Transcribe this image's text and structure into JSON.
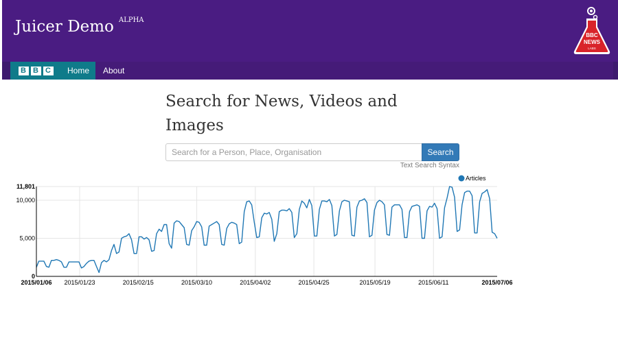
{
  "header": {
    "title": "Juicer Demo",
    "badge": "ALPHA",
    "logo": {
      "icon": "bbc-news-labs-flask-icon",
      "lines": [
        "BBC",
        "NEWS",
        "LABS"
      ],
      "color": "#d9232a"
    },
    "background": "#4a1c82"
  },
  "nav": {
    "brand_letters": [
      "B",
      "B",
      "C"
    ],
    "items": [
      {
        "label": "Home",
        "active": true
      },
      {
        "label": "About",
        "active": false
      }
    ],
    "accent": "#0f7b8a"
  },
  "main": {
    "title": "Search for News, Videos and Images",
    "search": {
      "placeholder": "Search for a Person, Place, Organisation",
      "value": "",
      "button_label": "Search"
    },
    "syntax_link": "Text Search Syntax"
  },
  "chart_data": {
    "type": "line",
    "series": [
      {
        "name": "Articles",
        "color": "#1f77b4"
      }
    ],
    "y_ticks": [
      "0",
      "5,000",
      "10,000",
      "11,801"
    ],
    "ylim": [
      0,
      11801
    ],
    "x_ticks": [
      "2015/01/06",
      "2015/01/23",
      "2015/02/15",
      "2015/03/10",
      "2015/04/02",
      "2015/04/25",
      "2015/05/19",
      "2015/06/11",
      "2015/07/06"
    ],
    "x_range": [
      "2015/01/06",
      "2015/07/06"
    ],
    "grid": true,
    "legend": "top-right",
    "values": [
      1200,
      2000,
      2000,
      2000,
      1300,
      1200,
      2100,
      2100,
      2200,
      2100,
      1900,
      1200,
      1200,
      1900,
      1900,
      1900,
      1900,
      1900,
      1100,
      1300,
      1700,
      2000,
      2100,
      2100,
      1300,
      500,
      1800,
      2100,
      1900,
      2200,
      3400,
      4200,
      3000,
      3200,
      5000,
      5200,
      5300,
      5600,
      4800,
      3000,
      3000,
      5200,
      5200,
      4900,
      5100,
      4800,
      3300,
      3400,
      5600,
      6200,
      5900,
      6800,
      6800,
      4300,
      3700,
      7000,
      7300,
      7200,
      6800,
      6400,
      4200,
      4100,
      6000,
      6500,
      7200,
      7100,
      6500,
      4100,
      4100,
      6600,
      6800,
      7000,
      7200,
      6800,
      4200,
      4100,
      6300,
      6900,
      7100,
      7000,
      6800,
      4300,
      4500,
      8500,
      9800,
      9900,
      9400,
      7100,
      5100,
      5200,
      7700,
      8300,
      8200,
      8400,
      7500,
      4600,
      5600,
      8500,
      8700,
      8700,
      8600,
      8900,
      8400,
      5100,
      5600,
      8800,
      9900,
      9600,
      9000,
      10100,
      9300,
      5300,
      5300,
      8800,
      9900,
      9900,
      9800,
      10100,
      9300,
      5300,
      5500,
      8600,
      9800,
      10000,
      9900,
      9800,
      5400,
      5300,
      9100,
      9900,
      10000,
      10200,
      9700,
      5200,
      5400,
      8700,
      9700,
      10000,
      9800,
      9400,
      5500,
      5400,
      9100,
      9400,
      9400,
      9400,
      8800,
      5100,
      5100,
      8500,
      9200,
      9300,
      9400,
      9200,
      5000,
      5000,
      8600,
      9200,
      9100,
      9600,
      8900,
      5000,
      5200,
      9000,
      10300,
      11800,
      11700,
      10400,
      5900,
      6100,
      9400,
      11000,
      11200,
      11200,
      10600,
      5700,
      5700,
      9800,
      10900,
      11100,
      11400,
      10200,
      5800,
      5600,
      5000
    ]
  }
}
